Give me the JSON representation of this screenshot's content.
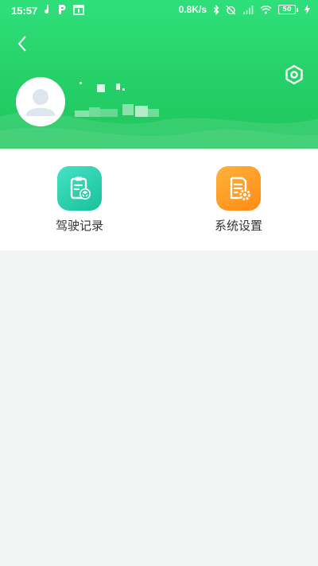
{
  "status_bar": {
    "time": "15:57",
    "net_speed": "0.8K/s",
    "battery_level": "50",
    "icons_left": [
      "music-note-icon",
      "parking-icon",
      "screen-icon"
    ],
    "icons_right": [
      "bluetooth-icon",
      "alarm-off-icon",
      "signal-icon",
      "wifi-icon",
      "charging-icon"
    ]
  },
  "header": {
    "gradient_top": "#2fe07a",
    "gradient_bottom": "#1fc65c",
    "back_icon": "chevron-left-icon",
    "settings_icon": "hexagon-gear-icon",
    "avatar_icon": "user-placeholder-icon"
  },
  "menu": {
    "items": [
      {
        "label": "驾驶记录",
        "icon": "clipboard-steering-icon",
        "color": "#1fc7a0"
      },
      {
        "label": "系统设置",
        "icon": "document-gear-icon",
        "color": "#ff9a22"
      }
    ]
  },
  "colors": {
    "page_background": "#f2f3f3",
    "card_background": "#ffffff",
    "label_text": "#333333"
  }
}
